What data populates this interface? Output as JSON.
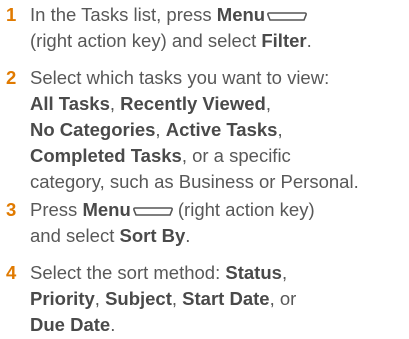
{
  "steps": [
    {
      "number": "1",
      "line1_pre": "In the Tasks list, press ",
      "line1_bold": "Menu",
      "line2_pre": "(right action key) and select ",
      "line2_bold": "Filter",
      "line2_post": "."
    },
    {
      "number": "2",
      "line1": "Select which tasks you want to view:",
      "line2_b1": "All Tasks",
      "line2_sep": ", ",
      "line2_b2": "Recently Viewed",
      "line2_post": ",",
      "line3_b1": "No Categories",
      "line3_sep": ", ",
      "line3_b2": "Active Tasks",
      "line3_post": ",",
      "line4_b1": "Completed Tasks",
      "line4_post": ", or a specific",
      "line5": "category, such as Business or Personal."
    },
    {
      "number": "3",
      "line1_pre": "Press ",
      "line1_bold": "Menu",
      "line1_post": " (right action key)",
      "line2_pre": "and select ",
      "line2_bold": "Sort By",
      "line2_post": "."
    },
    {
      "number": "4",
      "line1_pre": "Select the sort method: ",
      "line1_bold": "Status",
      "line1_post": ",",
      "line2_b1": "Priority",
      "line2_sep1": ", ",
      "line2_b2": "Subject",
      "line2_sep2": ", ",
      "line2_b3": "Start Date",
      "line2_post": ", or",
      "line3_bold": "Due Date",
      "line3_post": "."
    }
  ],
  "icons": {
    "menu_key": "menu-key-icon"
  },
  "colors": {
    "step_number": "#e07a00",
    "body_text": "#585858"
  }
}
